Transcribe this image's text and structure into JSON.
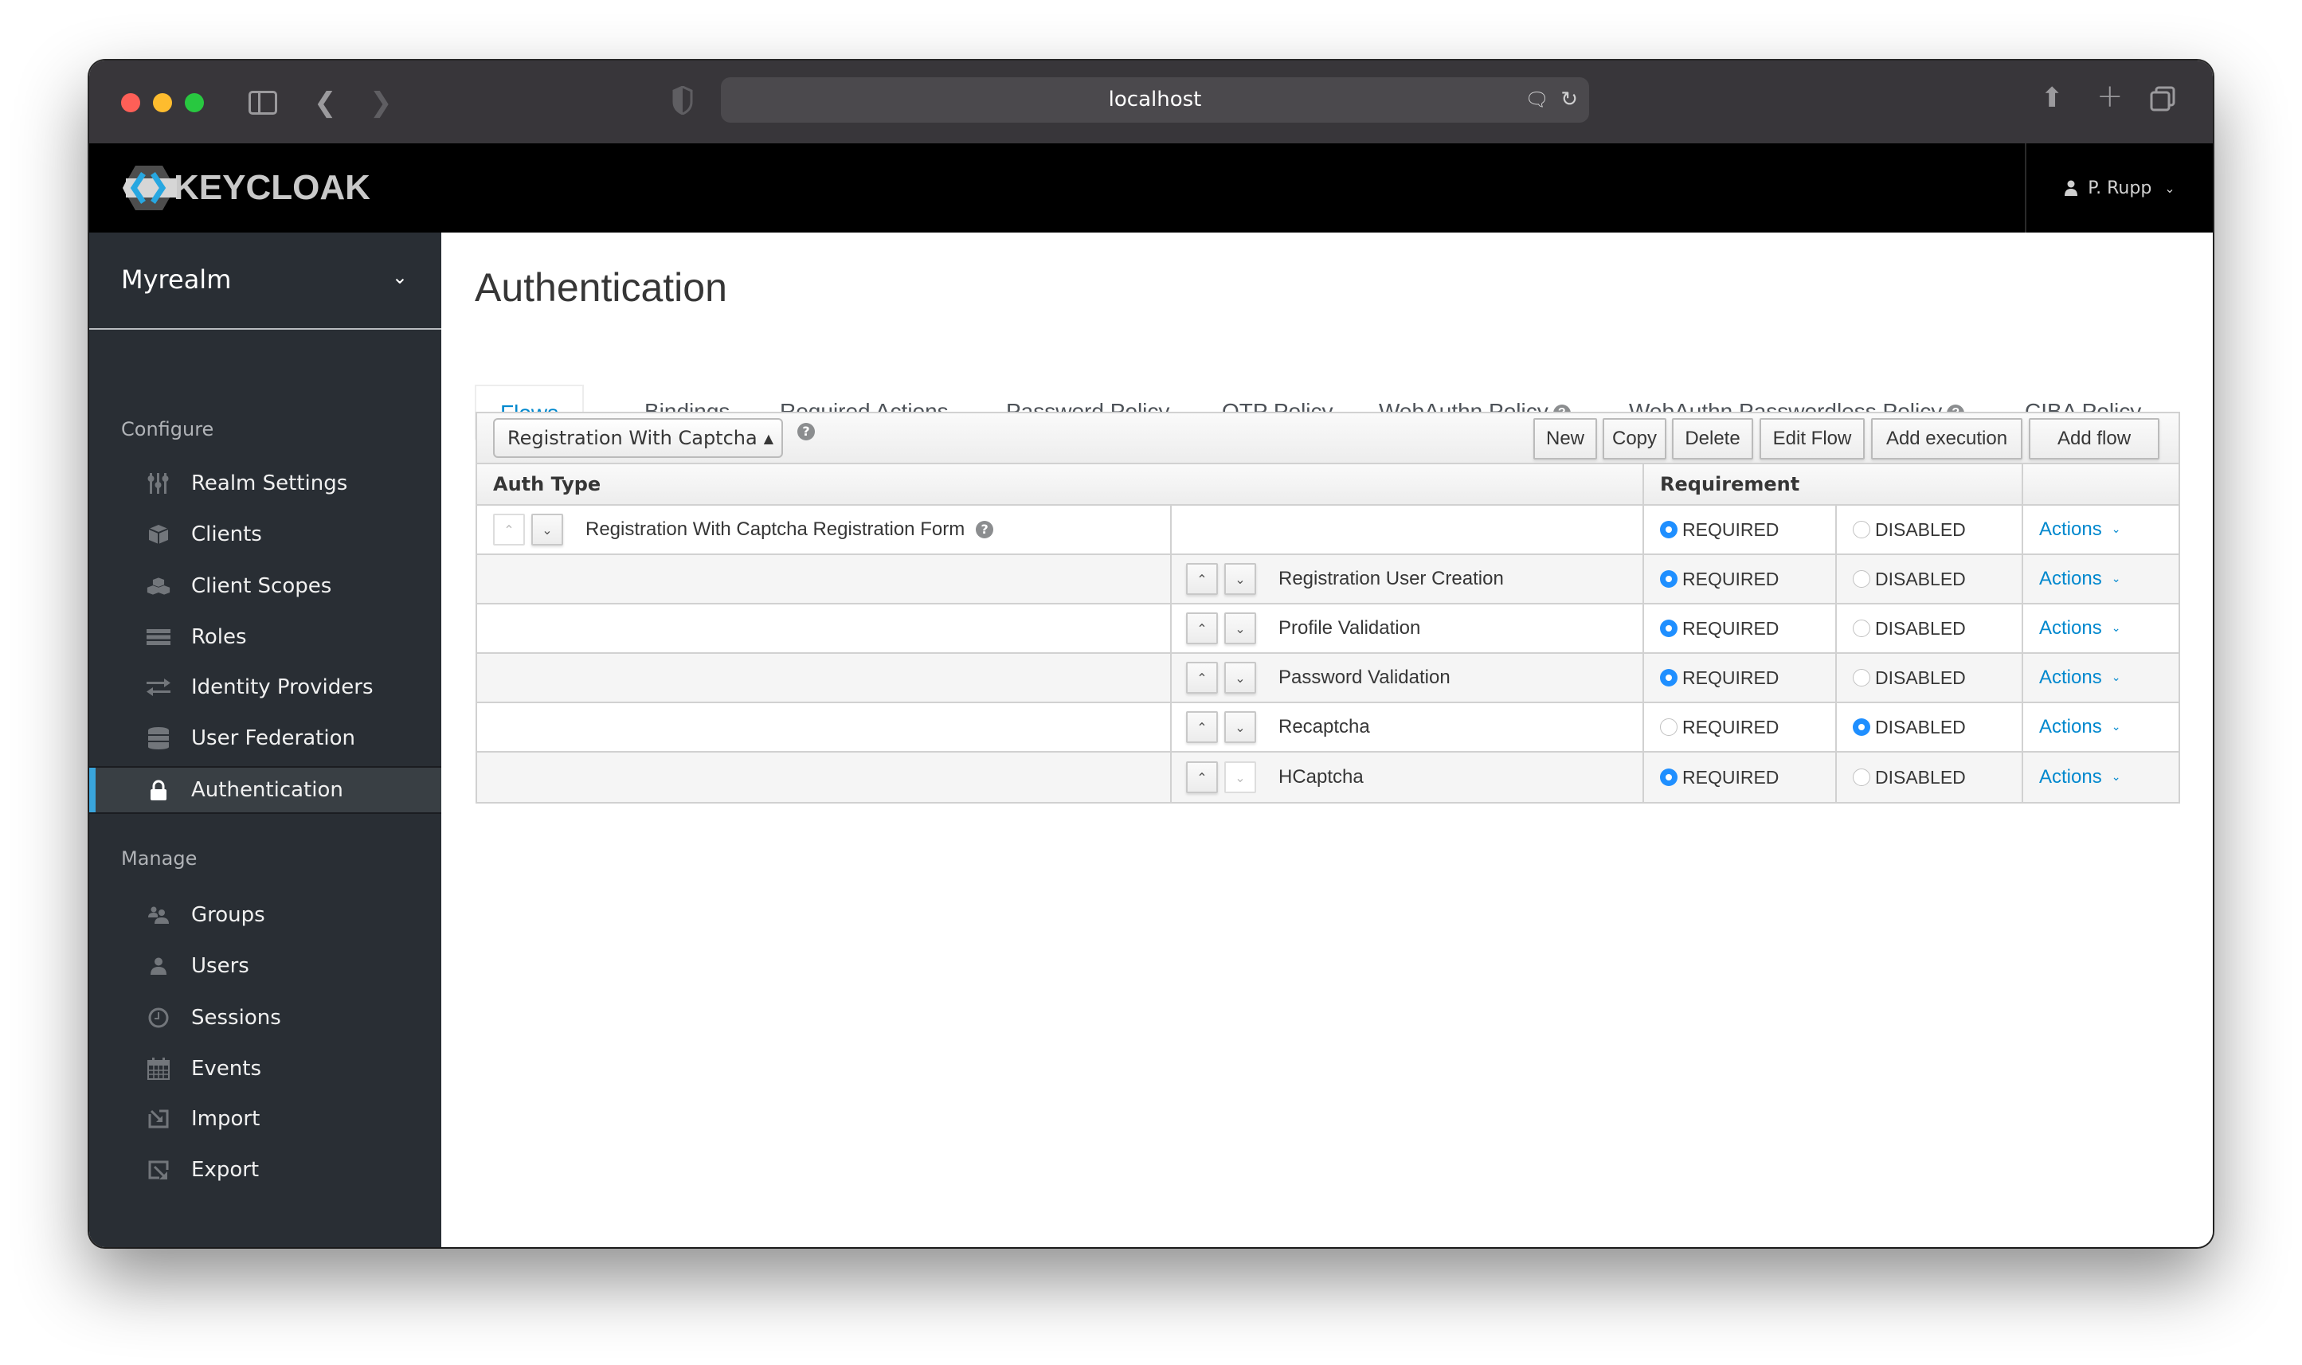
{
  "browser": {
    "url": "localhost",
    "colors": {
      "close": "#fe5f57",
      "minimize": "#febc2e",
      "maximize": "#28c840"
    }
  },
  "header": {
    "logo_text": "KEYCLOAK",
    "user_name": "P. Rupp"
  },
  "sidebar": {
    "realm": "Myrealm",
    "sections": [
      {
        "title": "Configure",
        "items": [
          {
            "label": "Realm Settings",
            "icon": "sliders-icon"
          },
          {
            "label": "Clients",
            "icon": "cube-icon"
          },
          {
            "label": "Client Scopes",
            "icon": "cubes-icon"
          },
          {
            "label": "Roles",
            "icon": "server-icon"
          },
          {
            "label": "Identity Providers",
            "icon": "exchange-icon"
          },
          {
            "label": "User Federation",
            "icon": "database-icon"
          },
          {
            "label": "Authentication",
            "icon": "lock-icon",
            "active": true
          }
        ]
      },
      {
        "title": "Manage",
        "items": [
          {
            "label": "Groups",
            "icon": "users-icon"
          },
          {
            "label": "Users",
            "icon": "user-icon"
          },
          {
            "label": "Sessions",
            "icon": "clock-icon"
          },
          {
            "label": "Events",
            "icon": "calendar-icon"
          },
          {
            "label": "Import",
            "icon": "import-icon"
          },
          {
            "label": "Export",
            "icon": "export-icon"
          }
        ]
      }
    ]
  },
  "main": {
    "title": "Authentication",
    "tabs": [
      {
        "label": "Flows",
        "active": true
      },
      {
        "label": "Bindings"
      },
      {
        "label": "Required Actions"
      },
      {
        "label": "Password Policy"
      },
      {
        "label": "OTP Policy"
      },
      {
        "label": "WebAuthn Policy",
        "help": true
      },
      {
        "label": "WebAuthn Passwordless Policy",
        "help": true
      },
      {
        "label": "CIBA Policy"
      }
    ],
    "toolbar": {
      "selected_flow": "Registration With Captcha",
      "buttons": [
        "New",
        "Copy",
        "Delete",
        "Edit Flow",
        "Add execution",
        "Add flow"
      ]
    },
    "table": {
      "headers": {
        "auth_type": "Auth Type",
        "requirement": "Requirement"
      },
      "rows": [
        {
          "name": "Registration With Captcha Registration Form",
          "level": 0,
          "help": true,
          "requirement": "REQUIRED",
          "options": [
            "REQUIRED",
            "DISABLED"
          ],
          "actions": "Actions",
          "down_disabled": false,
          "up_disabled": true
        },
        {
          "name": "Registration User Creation",
          "level": 1,
          "requirement": "REQUIRED",
          "options": [
            "REQUIRED",
            "DISABLED"
          ],
          "actions": "Actions"
        },
        {
          "name": "Profile Validation",
          "level": 1,
          "requirement": "REQUIRED",
          "options": [
            "REQUIRED",
            "DISABLED"
          ],
          "actions": "Actions"
        },
        {
          "name": "Password Validation",
          "level": 1,
          "requirement": "REQUIRED",
          "options": [
            "REQUIRED",
            "DISABLED"
          ],
          "actions": "Actions"
        },
        {
          "name": "Recaptcha",
          "level": 1,
          "requirement": "DISABLED",
          "options": [
            "REQUIRED",
            "DISABLED"
          ],
          "actions": "Actions"
        },
        {
          "name": "HCaptcha",
          "level": 1,
          "requirement": "REQUIRED",
          "options": [
            "REQUIRED",
            "DISABLED"
          ],
          "actions": "Actions",
          "down_disabled": true
        }
      ]
    },
    "colors": {
      "accent": "#0088ce",
      "radio_checked": "#1f8fff",
      "sidebar_bg": "#292e34",
      "active_indicator": "#39a5dc"
    }
  }
}
